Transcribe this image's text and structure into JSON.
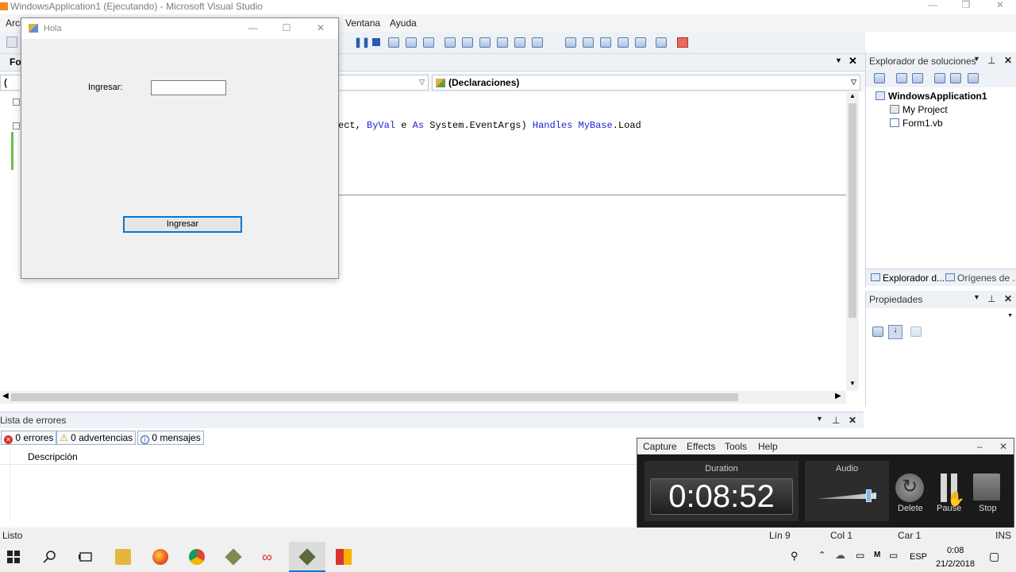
{
  "vs": {
    "window_title": "WindowsApplication1 (Ejecutando) - Microsoft Visual Studio",
    "menu": {
      "archivo_partial": "Arcl",
      "ventana": "Ventana",
      "ayuda": "Ayuda"
    },
    "doc_tab_partial": "For",
    "combo_left_partial": "(",
    "combo_right": "(Declaraciones)",
    "code_line": "ect, ByVal e As System.EventArgs) Handles MyBase.Load",
    "code_tokens": {
      "t1": "ect, ",
      "byval": "ByVal",
      "t2": " e ",
      "as": "As",
      "t3": " System.EventArgs) ",
      "handles": "Handles",
      "t4": " ",
      "mybase": "MyBase",
      "t5": ".Load"
    }
  },
  "solution_explorer": {
    "title": "Explorador de soluciones",
    "project": "WindowsApplication1",
    "items": [
      "My Project",
      "Form1.vb"
    ],
    "bottom_tabs": [
      "Explorador d...",
      "Orígenes de ..."
    ]
  },
  "properties": {
    "title": "Propiedades"
  },
  "error_list": {
    "title": "Lista de errores",
    "errors": "0 errores",
    "warnings": "0 advertencias",
    "messages": "0 mensajes",
    "column_description": "Descripción"
  },
  "status_bar": {
    "ready": "Listo",
    "line": "Lín 9",
    "col": "Col 1",
    "char": "Car 1",
    "mode": "INS"
  },
  "form": {
    "title": "Hola",
    "label": "Ingresar:",
    "textbox_value": "",
    "button_label": "Ingresar"
  },
  "capture": {
    "menu": [
      "Capture",
      "Effects",
      "Tools",
      "Help"
    ],
    "duration_label": "Duration",
    "duration": "0:08:52",
    "audio_label": "Audio",
    "audio_level": 0.55,
    "delete_label": "Delete",
    "pause_label": "Pause",
    "stop_label": "Stop"
  },
  "taskbar": {
    "lang": "ESP",
    "time": "0:08",
    "date": "21/2/2018"
  },
  "colors": {
    "keyword": "#1f1fd1",
    "form_bg": "#f0f0f0",
    "capture_bg": "#1a1a1a",
    "button_border": "#0078d7"
  }
}
